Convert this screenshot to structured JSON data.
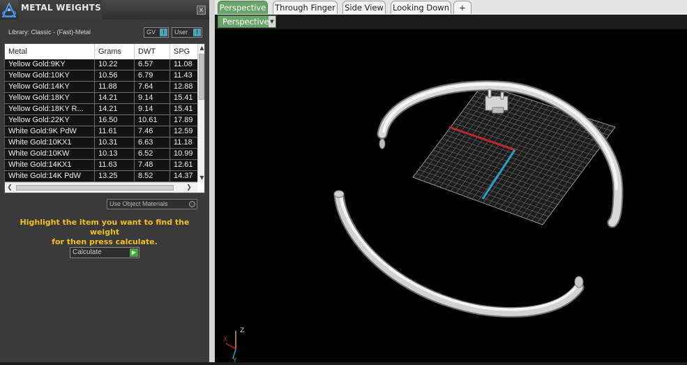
{
  "panel": {
    "title": "METAL WEIGHTS",
    "close_label": "x",
    "library_label": "Library: Classic - (Fast)-Metal",
    "toggle_gv": "GV",
    "toggle_user": "User",
    "toggle_mark": "I",
    "use_object_materials": "Use Object Materials",
    "hint_line1": "Highlight the item you want to find the weight",
    "hint_line2": "for then press calculate.",
    "calculate_label": "Calculate",
    "calculate_icon": "play-icon"
  },
  "table": {
    "columns": [
      "Metal",
      "Grams",
      "DWT",
      "SPG"
    ],
    "rows": [
      [
        "Yellow Gold:9KY",
        "10.22",
        "6.57",
        "11.08"
      ],
      [
        "Yellow Gold:10KY",
        "10.56",
        "6.79",
        "11.43"
      ],
      [
        "Yellow Gold:14KY",
        "11.88",
        "7.64",
        "12.88"
      ],
      [
        "Yellow Gold:18KY",
        "14.21",
        "9.14",
        "15.41"
      ],
      [
        "Yellow Gold:18KY R...",
        "14.21",
        "9.14",
        "15.41"
      ],
      [
        "Yellow Gold:22KY",
        "16.50",
        "10.61",
        "17.89"
      ],
      [
        "White Gold:9K PdW",
        "11.61",
        "7.46",
        "12.59"
      ],
      [
        "White Gold:10KX1",
        "10.31",
        "6.63",
        "11.18"
      ],
      [
        "White Gold:10KW",
        "10.13",
        "6.52",
        "10.99"
      ],
      [
        "White Gold:14KX1",
        "11.63",
        "7.48",
        "12.61"
      ],
      [
        "White Gold:14K PdW",
        "13.25",
        "8.52",
        "14.37"
      ]
    ]
  },
  "tabs": [
    {
      "label": "Perspective",
      "active": true
    },
    {
      "label": "Through Finger",
      "active": false
    },
    {
      "label": "Side View",
      "active": false
    },
    {
      "label": "Looking Down",
      "active": false
    },
    {
      "label": "+",
      "active": false
    }
  ],
  "viewport": {
    "view_select": "Perspective",
    "axis_z": "Z",
    "axis_x": "X",
    "axis_y": "Y"
  },
  "colors": {
    "accent_green": "#6aa46a",
    "hint_yellow": "#f0c020",
    "grid_x_axis": "#c0282c",
    "grid_y_axis": "#2aa0c8"
  }
}
